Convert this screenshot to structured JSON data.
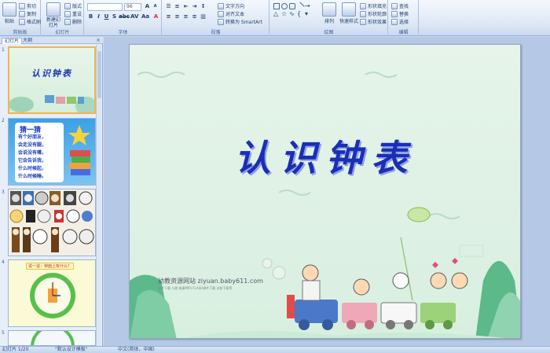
{
  "ribbon": {
    "clipboard": {
      "label": "剪贴板",
      "paste": "粘贴",
      "cut": "剪切",
      "copy": "复制",
      "format_painter": "格式刷"
    },
    "slides": {
      "label": "幻灯片",
      "new_slide": "新建幻灯片",
      "layout": "版式",
      "reset": "重设",
      "delete": "删除"
    },
    "font": {
      "label": "字体",
      "font_size": "96"
    },
    "paragraph": {
      "label": "段落",
      "text_direction": "文字方向",
      "align_text": "对齐文本",
      "convert_smartart": "转换为 SmartArt"
    },
    "drawing": {
      "label": "绘图",
      "arrange": "排列",
      "quick_styles": "快速样式",
      "shape_fill": "形状填充",
      "shape_outline": "形状轮廓",
      "shape_effects": "形状效果"
    },
    "editing": {
      "label": "编辑",
      "find": "查找",
      "replace": "替换",
      "select": "选择"
    }
  },
  "left_panel": {
    "tabs": [
      "幻灯片",
      "大纲"
    ],
    "close_glyph": "×",
    "thumbnails": [
      {
        "number": "1",
        "title": "认识钟表",
        "selected": true
      },
      {
        "number": "2",
        "heading": "猜一猜",
        "lines": [
          "有个好朋友，",
          "会走没有腿，",
          "会说没有嘴，",
          "它会告诉我，",
          "什么时候起，",
          "什么时候睡。"
        ],
        "selected": false
      },
      {
        "number": "3",
        "selected": false
      },
      {
        "number": "4",
        "heading": "说一说：钟面上有什么？",
        "selected": false
      },
      {
        "number": "5",
        "selected": false
      }
    ]
  },
  "slide": {
    "title": "认识钟表",
    "watermark": "幼教资源网站  ziyuan.baby611.com",
    "watermark_sub": "课件下载  儿歌  故事MP3  FLASH课件下载  试卷下载等"
  },
  "status": {
    "slide_counter": "幻灯片 1/20",
    "theme": "\"默认设计模板\"",
    "language": "中文(简体，中国)"
  },
  "colors": {
    "title": "#1a2fb5",
    "slide_bg": "#dcefe2",
    "selection": "#f1b64a"
  }
}
